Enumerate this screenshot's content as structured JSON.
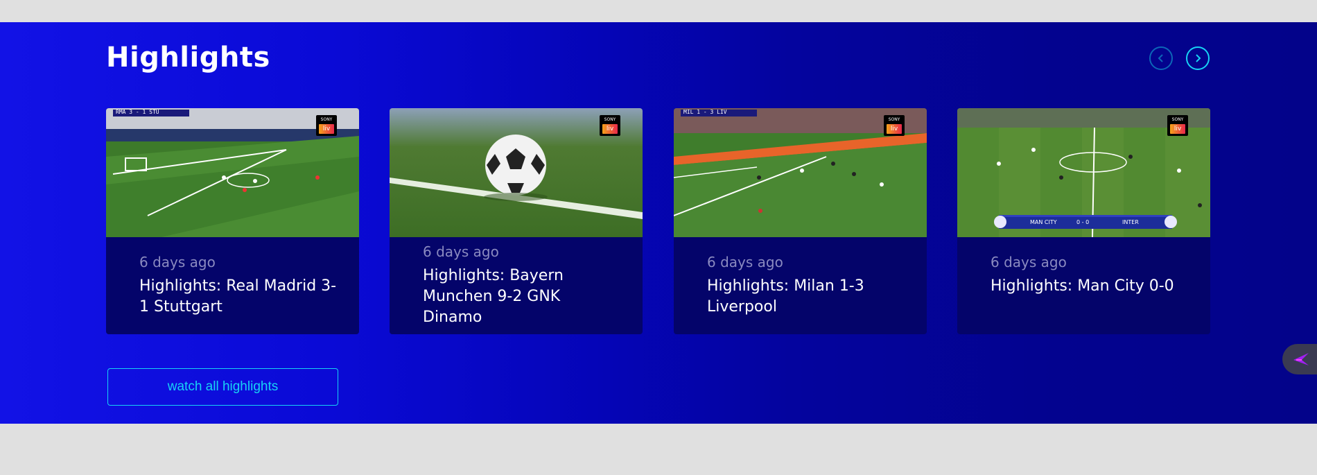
{
  "section": {
    "title": "Highlights"
  },
  "nav": {
    "prev_icon": "chevron-left-icon",
    "next_icon": "chevron-right-icon",
    "accent": "#17d3f5"
  },
  "cards": [
    {
      "date": "6 days ago",
      "title": "Highlights: Real Madrid 3-1 Stuttgart",
      "badge_top": "SONY",
      "badge_bottom": "liv",
      "scorebug": "RMA  3 - 1  STU"
    },
    {
      "date": "6 days ago",
      "title": "Highlights: Bayern Munchen 9-2 GNK Dinamo",
      "badge_top": "SONY",
      "badge_bottom": "liv"
    },
    {
      "date": "6 days ago",
      "title": "Highlights: Milan 1-3 Liverpool",
      "badge_top": "SONY",
      "badge_bottom": "liv",
      "scorebug": "MIL  1 - 3  LIV"
    },
    {
      "date": "6 days ago",
      "title": "Highlights: Man City 0-0",
      "badge_top": "SONY",
      "badge_bottom": "liv",
      "scorebug_home": "MAN CITY",
      "scorebug_score": "0 - 0",
      "scorebug_away": "INTER"
    }
  ],
  "footer": {
    "watch_all_label": "watch all highlights"
  },
  "side_tab": {
    "icon": "feather-logo-icon",
    "color": "#a020f0"
  }
}
